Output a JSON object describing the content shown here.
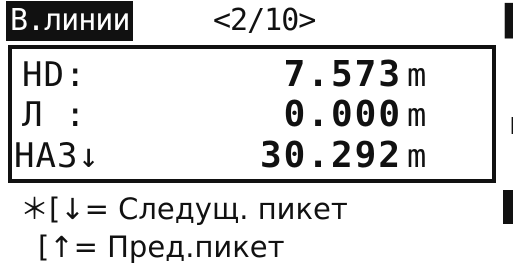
{
  "header": {
    "mode_label": "В.линии",
    "page_indicator": "<2/10>"
  },
  "measurements": [
    {
      "label": "HD:",
      "value": "7.573",
      "unit": "m"
    },
    {
      "label": "Л :",
      "value": "0.000",
      "unit": "m"
    },
    {
      "label": "НАЗ↓",
      "value": "30.292",
      "unit": "m"
    }
  ],
  "hints": [
    "＊[↓= Следущ. пикет",
    "[↑= Пред.пикет"
  ],
  "colors": {
    "foreground": "#111111",
    "background": "#ffffff"
  }
}
